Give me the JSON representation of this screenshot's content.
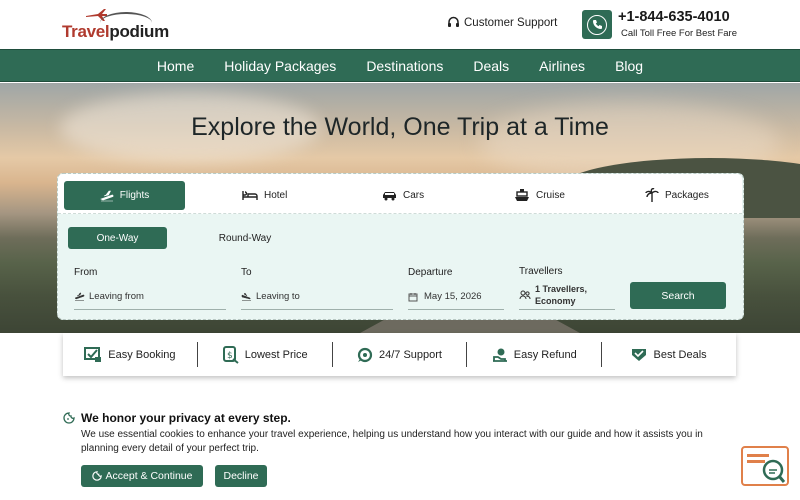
{
  "brand": {
    "name_part1": "Travel",
    "name_part2": "podium"
  },
  "header": {
    "support_label": "Customer Support",
    "phone_number": "+1-844-635-4010",
    "phone_sub": "Call Toll Free For Best Fare"
  },
  "nav": {
    "items": [
      "Home",
      "Holiday Packages",
      "Destinations",
      "Deals",
      "Airlines",
      "Blog"
    ]
  },
  "hero": {
    "title": "Explore the World, One Trip at a Time"
  },
  "search": {
    "tabs": [
      "Flights",
      "Hotel",
      "Cars",
      "Cruise",
      "Packages"
    ],
    "active_tab": "Flights",
    "trip_types": [
      "One-Way",
      "Round-Way"
    ],
    "active_trip": "One-Way",
    "from_label": "From",
    "from_value": "Leaving from",
    "to_label": "To",
    "to_value": "Leaving to",
    "departure_label": "Departure",
    "departure_value": "May 15, 2026",
    "travellers_label": "Travellers",
    "travellers_value_line1": "1 Travellers,",
    "travellers_value_line2": "Economy",
    "search_button": "Search"
  },
  "features": [
    "Easy Booking",
    "Lowest Price",
    "24/7 Support",
    "Easy Refund",
    "Best Deals"
  ],
  "privacy": {
    "title": "We honor your privacy at every step.",
    "text": "We use essential cookies to enhance your travel experience, helping us understand how you interact with our guide and how it assists you in planning every detail of your perfect trip.",
    "accept_label": "Accept & Continue",
    "decline_label": "Decline"
  },
  "colors": {
    "brand_green": "#2f6b55",
    "logo_red": "#b03a2e",
    "panel_bg": "#eaf6f3",
    "widget_orange": "#e0804a"
  },
  "icons": [
    "plane-icon",
    "headset-icon",
    "phone-icon",
    "hotel-bed-icon",
    "car-icon",
    "cruise-ship-icon",
    "palm-tree-icon",
    "calendar-icon",
    "users-icon",
    "cookie-icon",
    "chat-widget-icon"
  ]
}
